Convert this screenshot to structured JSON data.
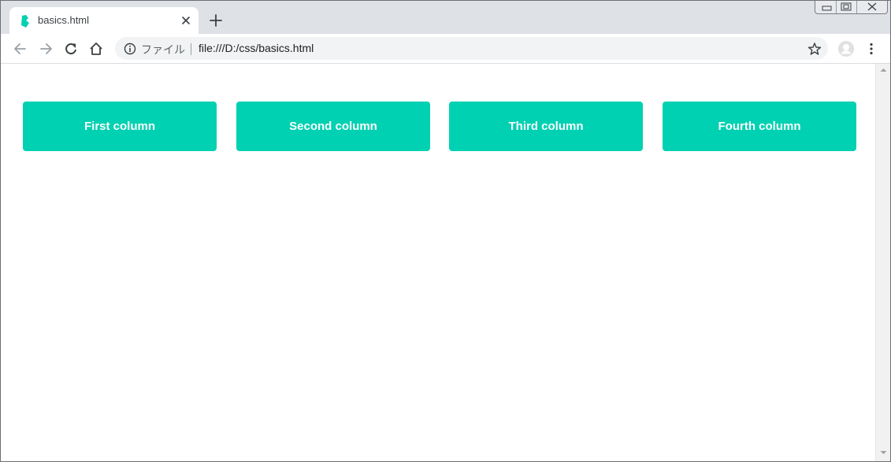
{
  "tab": {
    "title": "basics.html",
    "favicon": "bulma-logo-icon"
  },
  "toolbar": {
    "scheme_label": "ファイル",
    "url": "file:///D:/css/basics.html"
  },
  "columns": [
    {
      "label": "First column"
    },
    {
      "label": "Second column"
    },
    {
      "label": "Third column"
    },
    {
      "label": "Fourth column"
    }
  ],
  "colors": {
    "accent": "#00d1b2",
    "tab_strip": "#dee1e6",
    "omnibox": "#f1f3f4"
  }
}
